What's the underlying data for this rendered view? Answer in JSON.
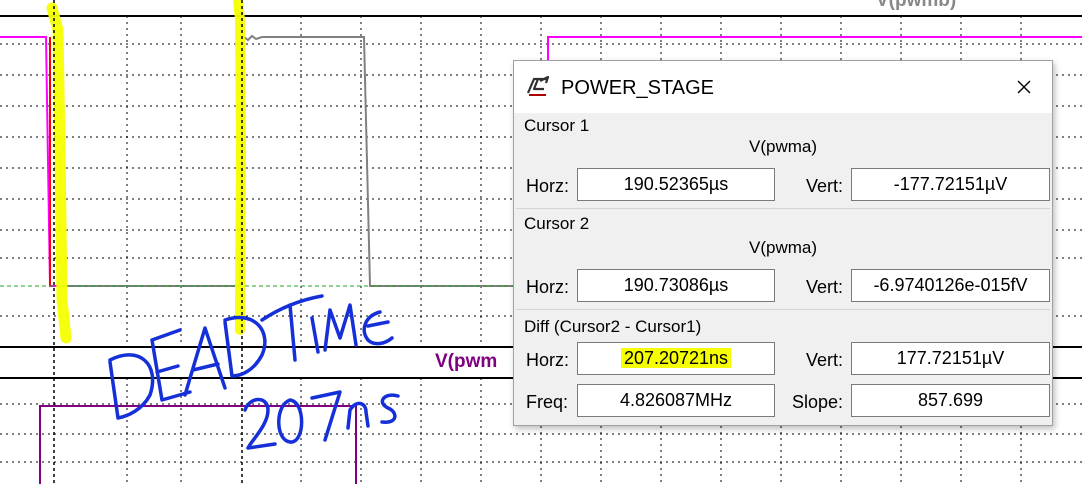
{
  "plot": {
    "top_pane_label": "V(pwmb)",
    "bottom_pane_label": "V(pwm",
    "colors": {
      "grid": "#000000",
      "trace_magenta": "#ff00ff",
      "trace_gray": "#808080",
      "trace_red": "#ff0000",
      "trace_purple": "#800080",
      "highlighter": "#f6ff00",
      "annotation_ink": "#1530d8",
      "label_purple": "#800080"
    }
  },
  "annotation": {
    "line1": "DEAD TIME",
    "line2": "207ns"
  },
  "dialog": {
    "title": "POWER_STAGE",
    "icon": "ltspice-logo-icon",
    "close_icon": "close-icon",
    "cursor1": {
      "title": "Cursor 1",
      "trace": "V(pwma)",
      "horz_label": "Horz:",
      "horz_value": "190.52365µs",
      "vert_label": "Vert:",
      "vert_value": "-177.72151µV"
    },
    "cursor2": {
      "title": "Cursor 2",
      "trace": "V(pwma)",
      "horz_label": "Horz:",
      "horz_value": "190.73086µs",
      "vert_label": "Vert:",
      "vert_value": "-6.9740126e-015fV"
    },
    "diff": {
      "title": "Diff (Cursor2 - Cursor1)",
      "horz_label": "Horz:",
      "horz_value": "207.20721ns",
      "vert_label": "Vert:",
      "vert_value": "177.72151µV",
      "freq_label": "Freq:",
      "freq_value": "4.826087MHz",
      "slope_label": "Slope:",
      "slope_value": "857.699"
    }
  }
}
